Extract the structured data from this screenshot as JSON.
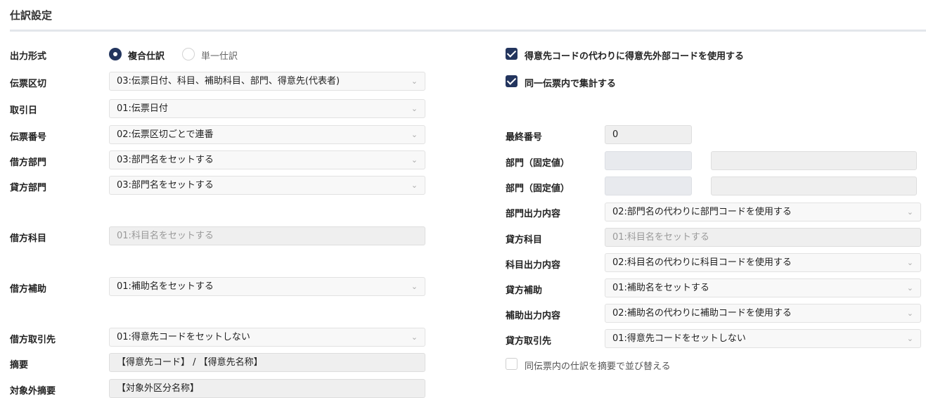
{
  "page": {
    "title": "仕訳設定"
  },
  "left": {
    "output_format": {
      "label": "出力形式",
      "options": [
        {
          "label": "複合仕訳",
          "selected": true
        },
        {
          "label": "単一仕訳",
          "selected": false
        }
      ]
    },
    "slip_break": {
      "label": "伝票区切",
      "value": "03:伝票日付、科目、補助科目、部門、得意先(代表者)"
    },
    "trade_date": {
      "label": "取引日",
      "value": "01:伝票日付"
    },
    "slip_number": {
      "label": "伝票番号",
      "value": "02:伝票区切ごとで連番"
    },
    "debit_dept": {
      "label": "借方部門",
      "value": "03:部門名をセットする"
    },
    "credit_dept": {
      "label": "貸方部門",
      "value": "03:部門名をセットする"
    },
    "debit_account": {
      "label": "借方科目",
      "value": "01:科目名をセットする"
    },
    "debit_sub": {
      "label": "借方補助",
      "value": "01:補助名をセットする"
    },
    "debit_partner": {
      "label": "借方取引先",
      "value": "01:得意先コードをセットしない"
    },
    "summary": {
      "label": "摘要",
      "value": "【得意先コード】 / 【得意先名称】"
    },
    "excluded_summary": {
      "label": "対象外摘要",
      "value": "【対象外区分名称】"
    }
  },
  "right": {
    "use_external_code": {
      "label": "得意先コードの代わりに得意先外部コードを使用する",
      "checked": true
    },
    "aggregate": {
      "label": "同一伝票内で集計する",
      "checked": true
    },
    "last_number": {
      "label": "最終番号",
      "value": "0"
    },
    "dept_fixed_1": {
      "label": "部門（固定値）",
      "code": "",
      "name": ""
    },
    "dept_fixed_2": {
      "label": "部門（固定値）",
      "code": "",
      "name": ""
    },
    "dept_output": {
      "label": "部門出力内容",
      "value": "02:部門名の代わりに部門コードを使用する"
    },
    "credit_account": {
      "label": "貸方科目",
      "value": "01:科目名をセットする"
    },
    "account_output": {
      "label": "科目出力内容",
      "value": "02:科目名の代わりに科目コードを使用する"
    },
    "credit_sub": {
      "label": "貸方補助",
      "value": "01:補助名をセットする"
    },
    "sub_output": {
      "label": "補助出力内容",
      "value": "02:補助名の代わりに補助コードを使用する"
    },
    "credit_partner": {
      "label": "貸方取引先",
      "value": "01:得意先コードをセットしない"
    },
    "sort_by_summary": {
      "label": "同伝票内の仕訳を摘要で並び替える",
      "checked": false
    }
  },
  "icons": {
    "select_arrow": "chevron-down-icon",
    "chevron_glyph": "⌄"
  },
  "colors": {
    "accent": "#23355e",
    "field_bg": "#efefef",
    "select_bg": "#f8f8f8"
  }
}
